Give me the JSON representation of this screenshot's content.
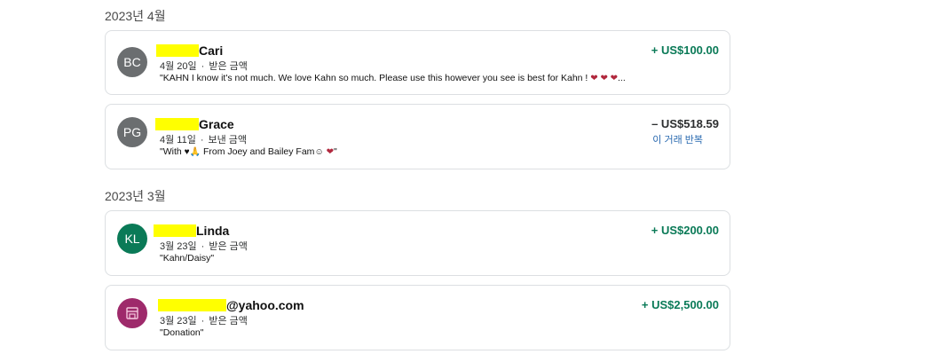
{
  "groups": [
    {
      "month": "2023년 4월",
      "transactions": [
        {
          "initials": "BC",
          "name": "Cari",
          "date": "4월 20일",
          "type": "받은 금액",
          "note": "\"KAHN I know it's not much. We love Kahn so much. Please use this however you see is best for Kahn ! ",
          "note_suffix": "...",
          "amount": "+ US$100.00"
        },
        {
          "initials": "PG",
          "name": "Grace",
          "date": "4월 11일",
          "type": "보낸 금액",
          "note_prefix": "\"With ",
          "note_mid": " From Joey and Bailey Fam",
          "note_end": "\"",
          "amount": "– US$518.59",
          "repeat_label": "이 거래 반복"
        }
      ]
    },
    {
      "month": "2023년 3월",
      "transactions": [
        {
          "initials": "KL",
          "name": "Linda",
          "date": "3월 23일",
          "type": "받은 금액",
          "note": "\"Kahn/Daisy\"",
          "amount": "+ US$200.00"
        },
        {
          "name": "@yahoo.com",
          "date": "3월 23일",
          "type": "받은 금액",
          "note": "\"Donation\"",
          "amount": "+ US$2,500.00",
          "icon": "storefront-icon"
        }
      ]
    }
  ],
  "colors": {
    "positive": "#0a7a57",
    "link": "#2a6ab0",
    "redaction": "#ffff00"
  }
}
